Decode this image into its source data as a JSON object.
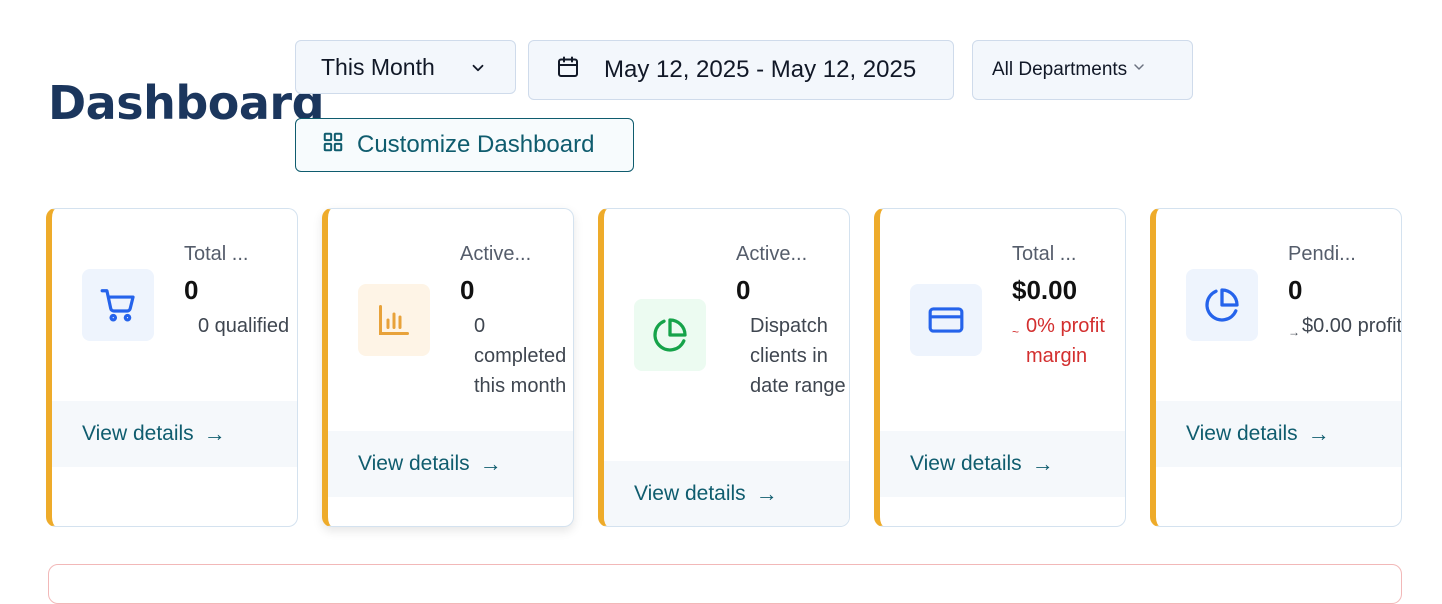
{
  "header": {
    "title": "Dashboard",
    "period_select": "This Month",
    "date_range": "May 12, 2025 - May 12, 2025",
    "department_select": "All Departments",
    "customize_label": "Customize Dashboard"
  },
  "cards": [
    {
      "label": "Total ...",
      "value": "0",
      "sub_indicator": "",
      "sub_text": "0 qualified",
      "footer": "View details",
      "icon": "cart-icon",
      "accent": "#eeab2a"
    },
    {
      "label": "Active...",
      "value": "0",
      "sub_indicator": "",
      "sub_text": "0 completed this month",
      "footer": "View details",
      "icon": "bar-chart-icon",
      "accent": "#eeab2a"
    },
    {
      "label": "Active...",
      "value": "0",
      "sub_indicator": "",
      "sub_text": "Dispatch clients in date range",
      "footer": "View details",
      "icon": "pie-chart-icon",
      "accent": "#eeab2a"
    },
    {
      "label": "Total ...",
      "value": "$0.00",
      "sub_indicator": "~",
      "sub_text": "0% profit margin",
      "footer": "View details",
      "icon": "credit-card-icon",
      "accent": "#eeab2a"
    },
    {
      "label": "Pendi...",
      "value": "0",
      "sub_indicator": "→",
      "sub_text": "$0.00 profit",
      "footer": "View details",
      "icon": "pie-chart-icon",
      "accent": "#eeab2a"
    }
  ],
  "colors": {
    "title": "#1b365d",
    "teal": "#0f5c6e",
    "accent": "#eeab2a",
    "negative": "#d32f2f",
    "icon_blue": "#2563eb",
    "icon_orange": "#e8a23a",
    "icon_green": "#16a34a"
  }
}
